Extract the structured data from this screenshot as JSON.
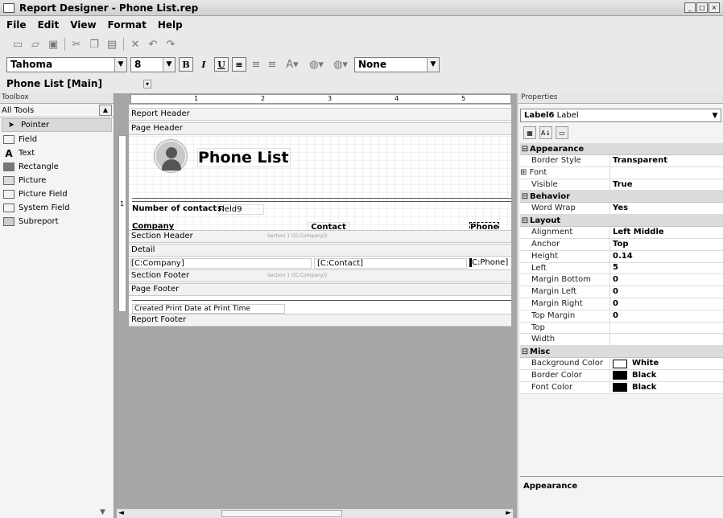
{
  "window": {
    "title": "Report Designer - Phone List.rep"
  },
  "menu": [
    "File",
    "Edit",
    "View",
    "Format",
    "Help"
  ],
  "format_toolbar": {
    "font": "Tahoma",
    "size": "8",
    "bold": "B",
    "italic": "I",
    "underline": "U",
    "border_style": "None"
  },
  "report_selector": {
    "value": "Phone List [Main]"
  },
  "toolbox": {
    "title": "Toolbox",
    "category": "All Tools",
    "tools": [
      "Pointer",
      "Field",
      "Text",
      "Rectangle",
      "Picture",
      "Picture Field",
      "System Field",
      "Subreport"
    ]
  },
  "ruler": {
    "marks": [
      "1",
      "2",
      "3",
      "4",
      "5"
    ],
    "vmark": "1"
  },
  "bands": {
    "report_header": "Report Header",
    "page_header": "Page Header",
    "section_header": "Section Header",
    "section_header_sub": "Section 1 ([C:Company])",
    "detail": "Detail",
    "section_footer": "Section Footer",
    "section_footer_sub": "Section 1 ([C:Company])",
    "page_footer": "Page Footer",
    "report_footer": "Report Footer"
  },
  "report": {
    "title": "Phone List",
    "contacts_label": "Number of contacts:",
    "contacts_field": "Field9",
    "col_company": "Company",
    "col_contact": "Contact",
    "col_phone": "Phone",
    "detail_company": "[C:Company]",
    "detail_contact": "[C:Contact]",
    "detail_phone": "C:Phone]",
    "footer_created": "Created",
    "footer_date": "Print Date",
    "footer_at": "at",
    "footer_time": "Print Time"
  },
  "properties": {
    "title": "Properties",
    "selected_name": "Label6",
    "selected_type": "Label",
    "categories": [
      {
        "name": "Appearance",
        "rows": [
          {
            "name": "Border Style",
            "value": "Transparent"
          },
          {
            "name": "Font",
            "value": "",
            "expand": "⊞"
          },
          {
            "name": "Visible",
            "value": "True"
          }
        ]
      },
      {
        "name": "Behavior",
        "rows": [
          {
            "name": "Word Wrap",
            "value": "Yes"
          }
        ]
      },
      {
        "name": "Layout",
        "rows": [
          {
            "name": "Alignment",
            "value": "Left Middle"
          },
          {
            "name": "Anchor",
            "value": "Top"
          },
          {
            "name": "Height",
            "value": "0.14"
          },
          {
            "name": "Left",
            "value": "5"
          },
          {
            "name": "Margin Bottom",
            "value": "0"
          },
          {
            "name": "Margin Left",
            "value": "0"
          },
          {
            "name": "Margin Right",
            "value": "0"
          },
          {
            "name": "Top Margin",
            "value": "0"
          },
          {
            "name": "Top",
            "value": ""
          },
          {
            "name": "Width",
            "value": ""
          }
        ]
      },
      {
        "name": "Misc",
        "rows": [
          {
            "name": "Background Color",
            "value": "White",
            "color": "#ffffff"
          },
          {
            "name": "Border Color",
            "value": "Black",
            "color": "#000000"
          },
          {
            "name": "Font Color",
            "value": "Black",
            "color": "#000000"
          }
        ]
      }
    ],
    "description_title": "Appearance"
  }
}
